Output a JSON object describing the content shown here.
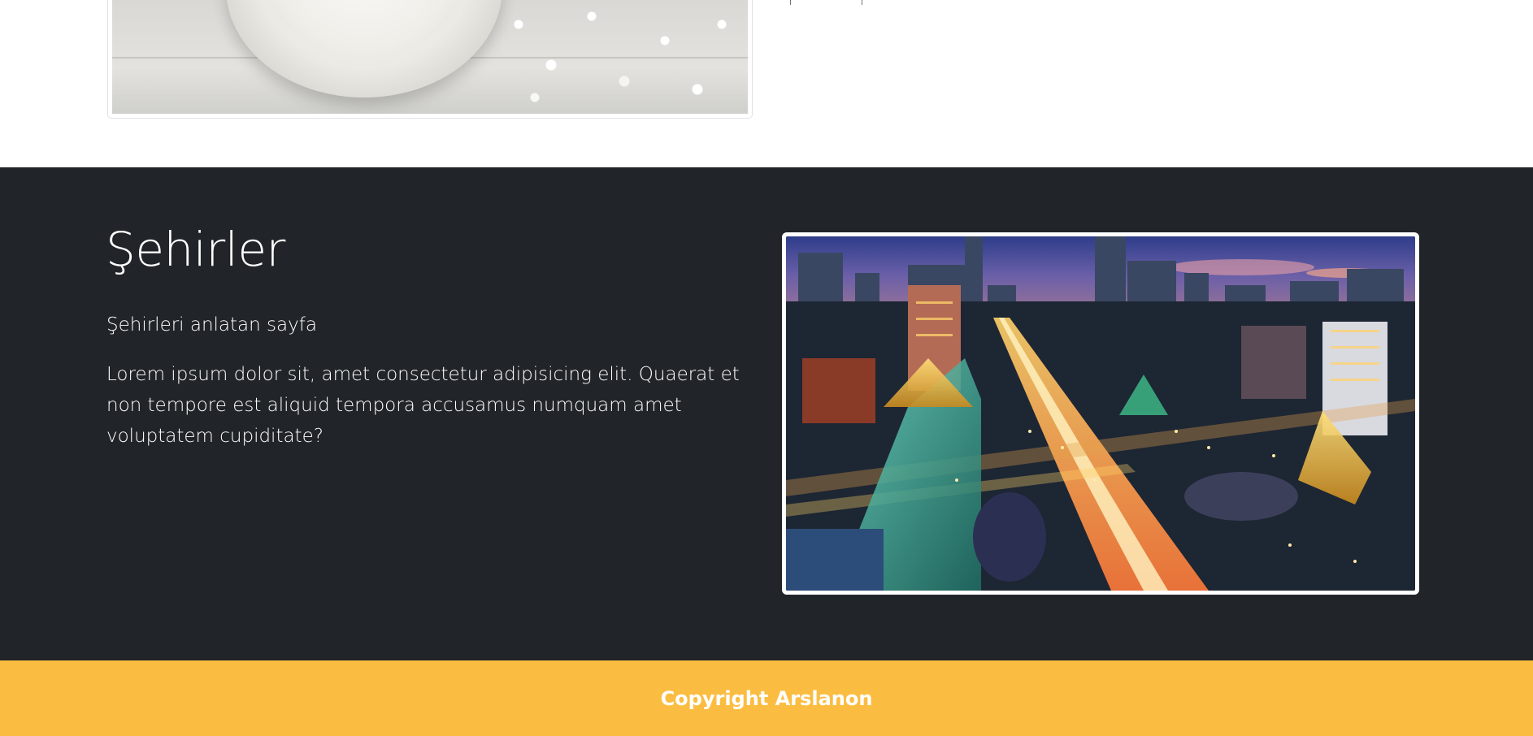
{
  "top_section": {
    "image_alt": "coffee cup with white flowers"
  },
  "cities_section": {
    "title": "Şehirler",
    "subtitle": "Şehirleri anlatan sayfa",
    "body": "Lorem ipsum dolor sit, amet consectetur adipisicing elit. Quaerat et non tempore est aliquid tempora accusamus numquam amet voluptatem cupiditate?",
    "image_alt": "city at night with light trails"
  },
  "footer": {
    "copyright": "Copyright Arslanon"
  },
  "colors": {
    "dark_bg": "#212529",
    "footer_bg": "#fbbd41",
    "text_light": "#ffffff"
  }
}
